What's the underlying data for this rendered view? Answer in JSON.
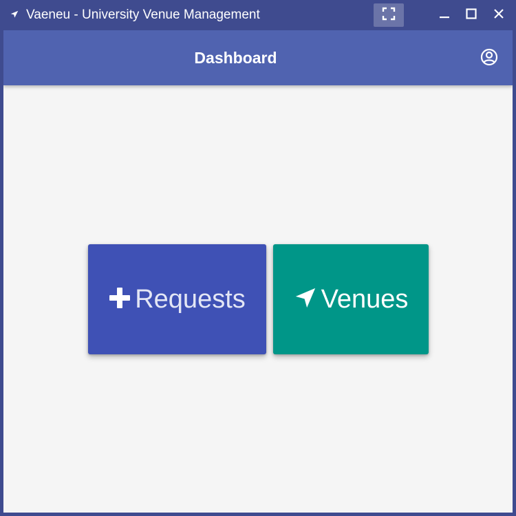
{
  "window": {
    "title": "Vaeneu - University Venue Management",
    "icons": {
      "app": "navigation-arrow-icon",
      "fullscreen": "fullscreen-icon",
      "minimize": "minimize-icon",
      "maximize": "maximize-icon",
      "close": "close-icon"
    }
  },
  "appbar": {
    "title": "Dashboard",
    "account_icon": "account-circle-icon"
  },
  "tiles": [
    {
      "label": "Requests",
      "icon": "plus-icon",
      "color": "#3f51b5"
    },
    {
      "label": "Venues",
      "icon": "navigation-arrow-icon",
      "color": "#009688"
    }
  ],
  "colors": {
    "titlebar": "#3f4b8f",
    "appbar": "#5063b0",
    "background": "#f5f5f5"
  }
}
